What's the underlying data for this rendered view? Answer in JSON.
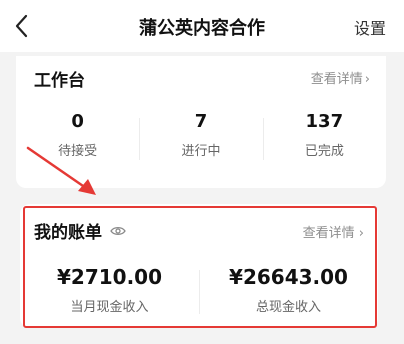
{
  "header": {
    "title": "蒲公英内容合作",
    "settings_label": "设置"
  },
  "workbench": {
    "title": "工作台",
    "detail_link": "查看详情",
    "stats": [
      {
        "value": "0",
        "label": "待接受"
      },
      {
        "value": "7",
        "label": "进行中"
      },
      {
        "value": "137",
        "label": "已完成"
      }
    ]
  },
  "bill": {
    "title": "我的账单",
    "detail_link": "查看详情",
    "stats": [
      {
        "value": "¥2710.00",
        "label": "当月现金收入"
      },
      {
        "value": "¥26643.00",
        "label": "总现金收入"
      }
    ]
  },
  "colors": {
    "highlight": "#e53935",
    "background": "#f3f3f3"
  },
  "icons": {
    "back": "chevron-left-icon",
    "eye": "eye-icon",
    "link_chevron": "chevron-right-icon"
  }
}
